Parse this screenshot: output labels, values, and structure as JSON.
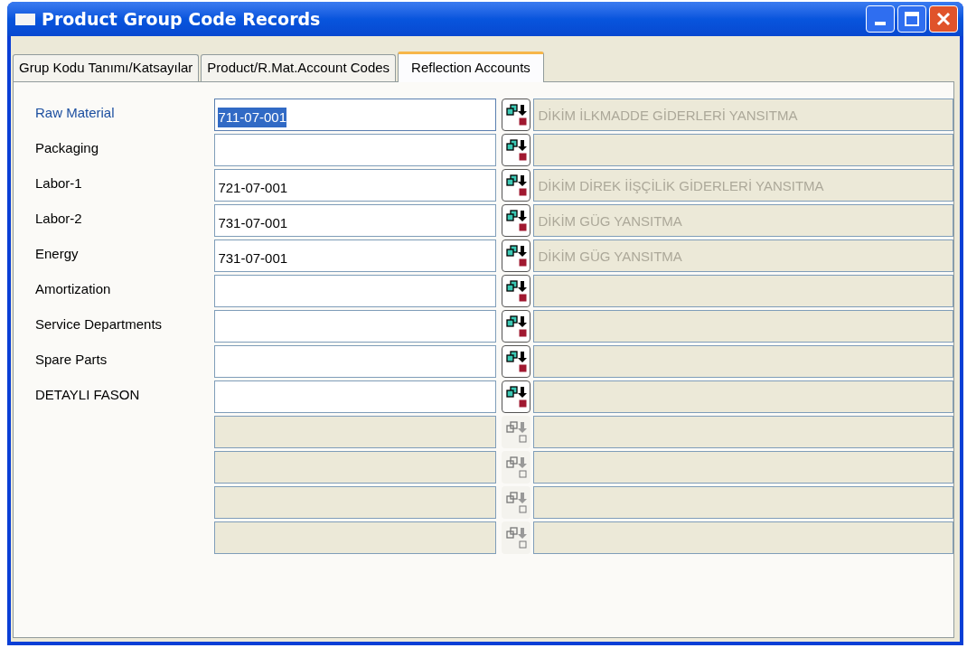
{
  "window": {
    "title": "Product Group Code Records"
  },
  "tabs": [
    {
      "label": "Grup Kodu Tanımı/Katsayılar",
      "selected": false
    },
    {
      "label": "Product/R.Mat.Account Codes",
      "selected": false
    },
    {
      "label": "Reflection Accounts",
      "selected": true
    }
  ],
  "rows": [
    {
      "label": "Raw Material",
      "code": "711-07-001",
      "description": "DİKİM İLKMADDE GİDERLERİ YANSITMA",
      "focused": true,
      "disabled": false
    },
    {
      "label": "Packaging",
      "focused": false,
      "disabled": false
    },
    {
      "label": "Labor-1",
      "code": "721-07-001",
      "description": "DİKİM DİREK İİŞÇİLİK GİDERLERİ YANSITMA",
      "focused": false,
      "disabled": false
    },
    {
      "label": "Labor-2",
      "code": "731-07-001",
      "description": "DİKİM GÜG YANSITMA",
      "focused": false,
      "disabled": false
    },
    {
      "label": "Energy",
      "code": "731-07-001",
      "description": "DİKİM GÜG YANSITMA",
      "focused": false,
      "disabled": false
    },
    {
      "label": "Amortization",
      "focused": false,
      "disabled": false
    },
    {
      "label": "Service Departments",
      "focused": false,
      "disabled": false
    },
    {
      "label": "Spare Parts",
      "focused": false,
      "disabled": false
    },
    {
      "label": "DETAYLI FASON",
      "focused": false,
      "disabled": false
    },
    {
      "disabled": true
    },
    {
      "disabled": true
    },
    {
      "disabled": true
    },
    {
      "disabled": true
    }
  ]
}
